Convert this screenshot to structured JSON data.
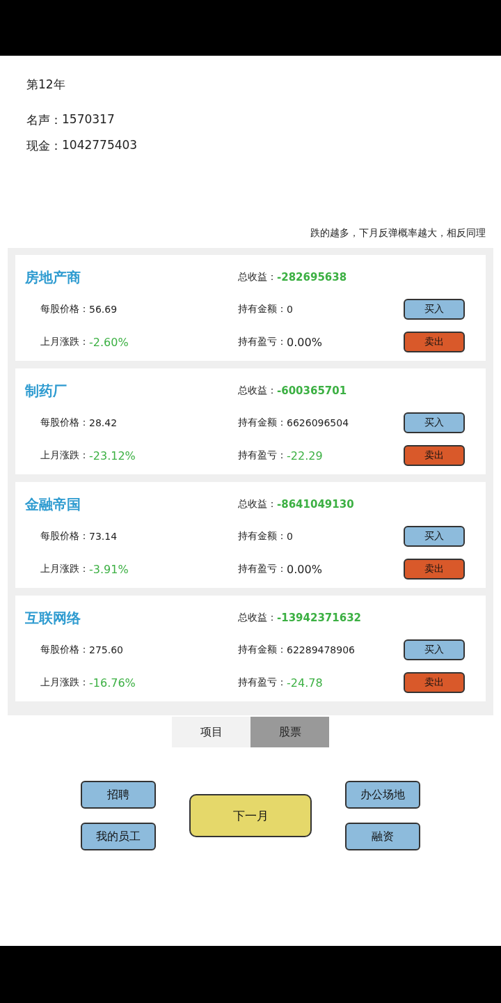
{
  "header": {
    "year": "第12年",
    "fame_label": "名声：",
    "fame": "1570317",
    "cash_label": "现金：",
    "cash": "1042775403"
  },
  "hint": "跌的越多，下月反弹概率越大，相反同理",
  "stocks": [
    {
      "name": "房地产商",
      "total_label": "总收益：",
      "total": "-282695638",
      "price_label": "每股价格：",
      "price": "56.69",
      "holding_label": "持有金额：",
      "holding": "0",
      "change_label": "上月涨跌：",
      "change": {
        "text": "-2.60%",
        "color": "#3cb043"
      },
      "pnl_label": "持有盈亏：",
      "pnl": {
        "text": "0.00%",
        "color": "#222222"
      },
      "buy": "买入",
      "sell": "卖出"
    },
    {
      "name": "制药厂",
      "total_label": "总收益：",
      "total": "-600365701",
      "price_label": "每股价格：",
      "price": "28.42",
      "holding_label": "持有金额：",
      "holding": "6626096504",
      "change_label": "上月涨跌：",
      "change": {
        "text": "-23.12%",
        "color": "#3cb043"
      },
      "pnl_label": "持有盈亏：",
      "pnl": {
        "text": "-22.29",
        "color": "#3cb043"
      },
      "buy": "买入",
      "sell": "卖出"
    },
    {
      "name": "金融帝国",
      "total_label": "总收益：",
      "total": "-8641049130",
      "price_label": "每股价格：",
      "price": "73.14",
      "holding_label": "持有金额：",
      "holding": "0",
      "change_label": "上月涨跌：",
      "change": {
        "text": "-3.91%",
        "color": "#3cb043"
      },
      "pnl_label": "持有盈亏：",
      "pnl": {
        "text": "0.00%",
        "color": "#222222"
      },
      "buy": "买入",
      "sell": "卖出"
    },
    {
      "name": "互联网络",
      "total_label": "总收益：",
      "total": "-13942371632",
      "price_label": "每股价格：",
      "price": "275.60",
      "holding_label": "持有金额：",
      "holding": "62289478906",
      "change_label": "上月涨跌：",
      "change": {
        "text": "-16.76%",
        "color": "#3cb043"
      },
      "pnl_label": "持有盈亏：",
      "pnl": {
        "text": "-24.78",
        "color": "#3cb043"
      },
      "buy": "买入",
      "sell": "卖出"
    }
  ],
  "tabs": [
    {
      "label": "项目",
      "selected": false
    },
    {
      "label": "股票",
      "selected": true
    }
  ],
  "actions": {
    "left": [
      "招聘",
      "我的员工"
    ],
    "center": "下一月",
    "right": [
      "办公场地",
      "融资"
    ]
  }
}
